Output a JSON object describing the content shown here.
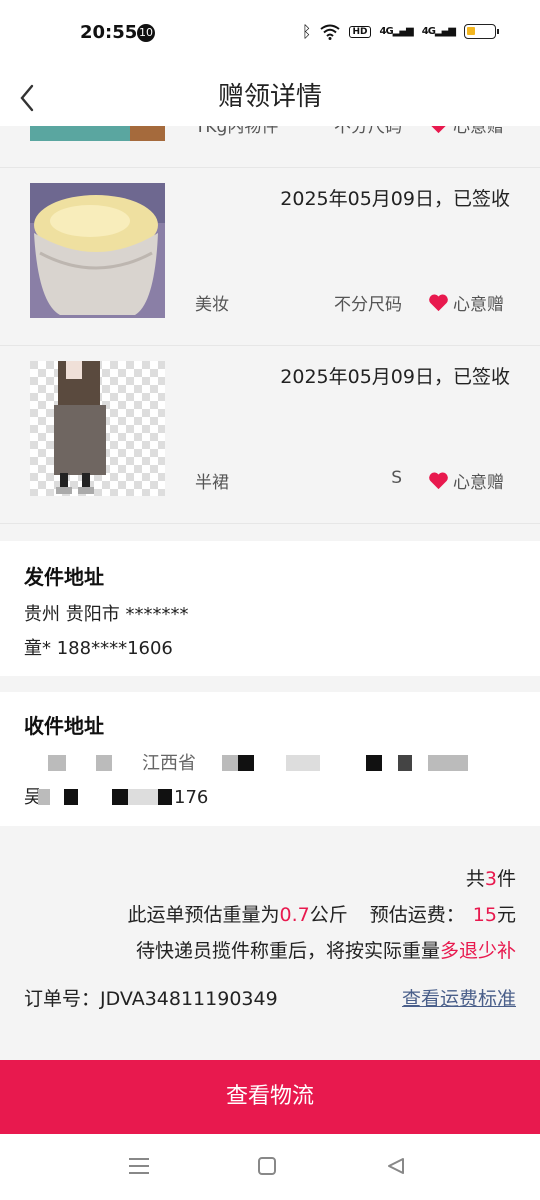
{
  "status_bar": {
    "time": "20:55",
    "notification_count": "10",
    "network_hd": "HD",
    "signal_1": "4G",
    "signal_2": "4G"
  },
  "header": {
    "title": "赠领详情"
  },
  "items": [
    {
      "category": "TKg内物件",
      "size": "不分尺码",
      "gift_label": "心意赠"
    },
    {
      "date_status": "2025年05月09日，已签收",
      "category": "美妆",
      "size": "不分尺码",
      "gift_label": "心意赠"
    },
    {
      "date_status": "2025年05月09日，已签收",
      "category": "半裙",
      "size": "S",
      "gift_label": "心意赠"
    }
  ],
  "sender": {
    "title": "发件地址",
    "address": "贵州 贵阳市 *******",
    "contact": "童* 188****1606"
  },
  "receiver": {
    "title": "收件地址",
    "line1_partial": "江西省",
    "line2_prefix": "吴",
    "line2_suffix": "176"
  },
  "summary": {
    "count_prefix": "共",
    "count": "3",
    "count_suffix": "件",
    "weight_prefix": "此运单预估重量为",
    "weight": "0.7",
    "weight_unit": "公斤",
    "fee_label": "预估运费：",
    "fee": "15",
    "fee_unit": "元",
    "note_prefix": "待快递员揽件称重后，将按实际重量",
    "note_highlight": "多退少补",
    "order_label": "订单号：",
    "order_number": "JDVA34811190349",
    "fee_link": "查看运费标准"
  },
  "actions": {
    "logistics_button": "查看物流"
  },
  "colors": {
    "accent": "#e8194e",
    "link": "#4a5f8a"
  }
}
